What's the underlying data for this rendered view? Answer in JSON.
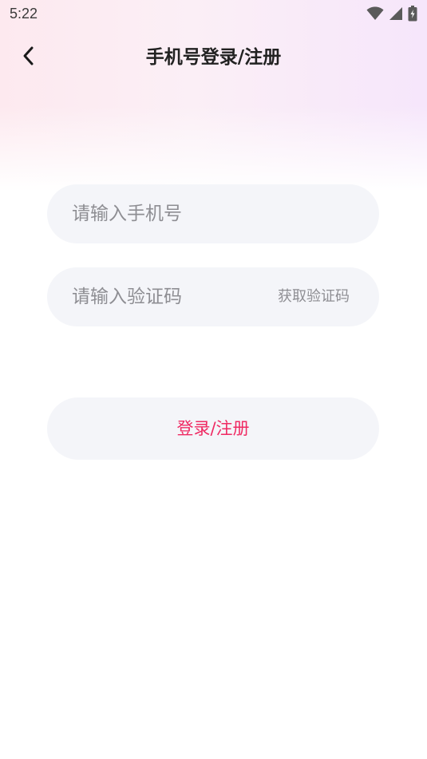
{
  "status_bar": {
    "time": "5:22",
    "icons": [
      "wifi-icon",
      "cell-signal-icon",
      "battery-charging-icon"
    ]
  },
  "header": {
    "back_icon": "chevron-left-icon",
    "title": "手机号登录/注册"
  },
  "form": {
    "phone_placeholder": "请输入手机号",
    "phone_value": "",
    "code_placeholder": "请输入验证码",
    "code_value": "",
    "get_code_label": "获取验证码",
    "submit_label": "登录/注册"
  },
  "colors": {
    "accent": "#ef2a63",
    "field_background": "#f4f5f9",
    "placeholder": "#8e8e93",
    "title": "#222222"
  }
}
